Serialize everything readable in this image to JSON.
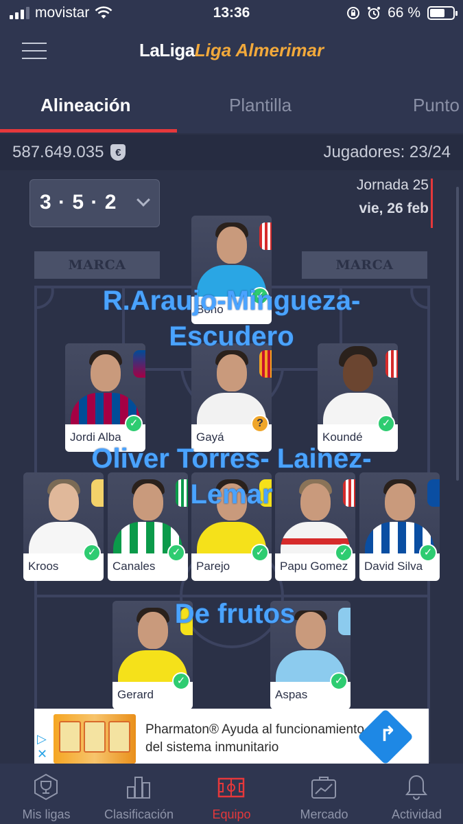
{
  "status_bar": {
    "carrier": "movistar",
    "time": "13:36",
    "battery": "66 %"
  },
  "header": {
    "title_brand": "LaLiga",
    "title_league": "Liga Almerimar"
  },
  "tabs": [
    {
      "label": "Alineación"
    },
    {
      "label": "Plantilla"
    },
    {
      "label": "Punto"
    }
  ],
  "budget": {
    "amount": "587.649.035",
    "currency_symbol": "€",
    "players": "Jugadores: 23/24"
  },
  "lineup": {
    "formation": "3 · 5 · 2",
    "jornada": "Jornada 25",
    "date": "vie, 26 feb",
    "sponsor": "MARCA"
  },
  "players": {
    "goalkeeper": {
      "name": "Bono",
      "status": "check"
    },
    "defenders": [
      {
        "name": "Jordi Alba",
        "status": "check"
      },
      {
        "name": "Gayá",
        "status": "question"
      },
      {
        "name": "Koundé",
        "status": "check"
      }
    ],
    "midfielders": [
      {
        "name": "Kroos",
        "status": "check"
      },
      {
        "name": "Canales",
        "status": "check"
      },
      {
        "name": "Parejo",
        "status": "check"
      },
      {
        "name": "Papu Gomez",
        "status": "check"
      },
      {
        "name": "David Silva",
        "status": "check"
      }
    ],
    "forwards": [
      {
        "name": "Gerard",
        "status": "check"
      },
      {
        "name": "Aspas",
        "status": "check"
      }
    ]
  },
  "overlays": {
    "defense_line1": "R.Araujo-Mingueza-",
    "defense_line2": "Escudero",
    "midfield_line1": "Oliver Torres- Lainez-",
    "midfield_line2": "Lemar",
    "forward_line1": "De frutos"
  },
  "ad": {
    "line1": "Pharmaton® Ayuda al funcionamiento",
    "line2": "del sistema inmunitario"
  },
  "bottom_nav": [
    {
      "label": "Mis ligas",
      "icon": "trophy-icon"
    },
    {
      "label": "Clasificación",
      "icon": "bar-chart-icon"
    },
    {
      "label": "Equipo",
      "icon": "pitch-icon"
    },
    {
      "label": "Mercado",
      "icon": "market-icon"
    },
    {
      "label": "Actividad",
      "icon": "bell-icon"
    }
  ],
  "colors": {
    "background": "#2b3147",
    "accent": "#e5383b",
    "league": "#f2a93b",
    "check": "#2ecc71",
    "overlay_text": "#4aa3ff"
  }
}
